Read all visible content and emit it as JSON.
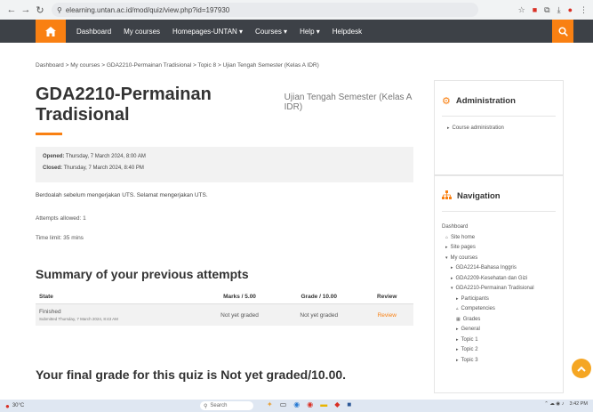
{
  "browser": {
    "url": "elearning.untan.ac.id/mod/quiz/view.php?id=197930",
    "back_glyph": "←",
    "forward_glyph": "→",
    "reload_glyph": "↻",
    "right_icons": [
      "☆",
      "■",
      "⧉",
      "⤓",
      "●",
      "⋮"
    ]
  },
  "navbar": {
    "home_icon": "home-icon",
    "links": [
      "Dashboard",
      "My courses",
      "Homepages-UNTAN ▾",
      "Courses ▾",
      "Help ▾",
      "Helpdesk"
    ],
    "accent": "#f98012"
  },
  "breadcrumb": "Dashboard > My courses > GDA2210-Permainan Tradisional > Topic 8 > Ujian Tengah Semester (Kelas A IDR)",
  "page": {
    "course_title": "GDA2210-Permainan Tradisional",
    "quiz_title": "Ujian Tengah Semester (Kelas A IDR)",
    "opened_label": "Opened:",
    "opened_value": "Thursday, 7 March 2024, 8:00 AM",
    "closed_label": "Closed:",
    "closed_value": "Thursday, 7 March 2024, 8:40 PM",
    "message": "Berdoalah sebelum mengerjakan UTS. Selamat mengerjakan UTS.",
    "attempts_allowed": "Attempts allowed: 1",
    "time_limit": "Time limit: 35 mins",
    "summary_heading": "Summary of your previous attempts",
    "table": {
      "headers": [
        "State",
        "Marks / 5.00",
        "Grade / 10.00",
        "Review"
      ],
      "rows": [
        {
          "state": "Finished",
          "submitted": "Submitted Thursday, 7 March 2024, 8:43 AM",
          "marks": "Not yet graded",
          "grade": "Not yet graded",
          "review": "Review"
        }
      ]
    },
    "final_grade": "Your final grade for this quiz is Not yet graded/10.00."
  },
  "admin_block": {
    "title": "Administration",
    "item": "Course administration"
  },
  "nav_block": {
    "title": "Navigation",
    "items": [
      {
        "label": "Dashboard",
        "level": "l1",
        "marker": ""
      },
      {
        "label": "Site home",
        "level": "l2",
        "marker": "⌂"
      },
      {
        "label": "Site pages",
        "level": "l2",
        "marker": "▸"
      },
      {
        "label": "My courses",
        "level": "l2",
        "marker": "▾"
      },
      {
        "label": "GDA2214-Bahasa Inggris",
        "level": "l3",
        "marker": "▸"
      },
      {
        "label": "GDA2209-Kesehatan dan Gizi",
        "level": "l3",
        "marker": "▸"
      },
      {
        "label": "GDA2210-Permainan Tradisional",
        "level": "l3",
        "marker": "▾"
      },
      {
        "label": "Participants",
        "level": "l4",
        "marker": "▸"
      },
      {
        "label": "Competencies",
        "level": "l4",
        "marker": "▵"
      },
      {
        "label": "Grades",
        "level": "l4",
        "marker": "▦"
      },
      {
        "label": "General",
        "level": "l4",
        "marker": "▸"
      },
      {
        "label": "Topic 1",
        "level": "l4",
        "marker": "▸"
      },
      {
        "label": "Topic 2",
        "level": "l4",
        "marker": "▸"
      },
      {
        "label": "Topic 3",
        "level": "l4",
        "marker": "▸"
      }
    ]
  },
  "taskbar": {
    "weather": "30°C",
    "search_placeholder": "Search",
    "time": "3:42 PM"
  }
}
